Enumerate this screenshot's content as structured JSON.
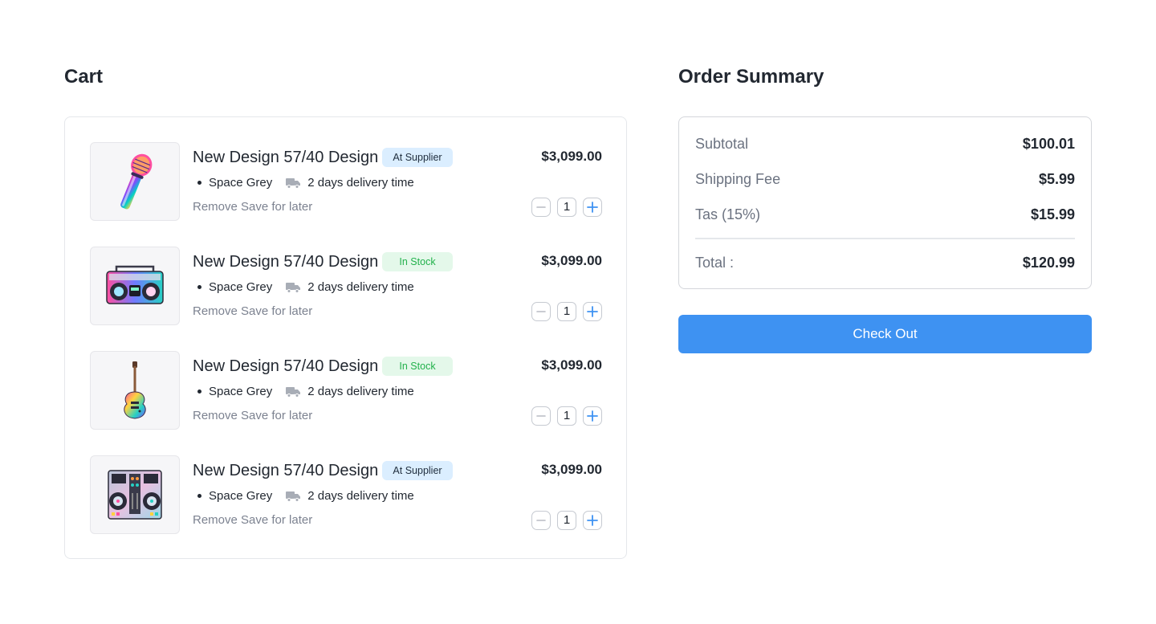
{
  "cart": {
    "title": "Cart",
    "items": [
      {
        "name": "New Design 57/40 Design",
        "badge": "At Supplier",
        "badge_type": "supplier",
        "price": "$3,099.00",
        "color": "Space Grey",
        "delivery": "2 days delivery time",
        "remove_label": "Remove",
        "save_label": "Save for later",
        "quantity": "1",
        "image_icon": "microphone-icon"
      },
      {
        "name": "New Design 57/40 Design",
        "badge": "In Stock",
        "badge_type": "stock",
        "price": "$3,099.00",
        "color": "Space Grey",
        "delivery": "2 days delivery time",
        "remove_label": "Remove",
        "save_label": "Save for later",
        "quantity": "1",
        "image_icon": "boombox-icon"
      },
      {
        "name": "New Design 57/40 Design",
        "badge": "In Stock",
        "badge_type": "stock",
        "price": "$3,099.00",
        "color": "Space Grey",
        "delivery": "2 days delivery time",
        "remove_label": "Remove",
        "save_label": "Save for later",
        "quantity": "1",
        "image_icon": "guitar-icon"
      },
      {
        "name": "New Design 57/40 Design",
        "badge": "At Supplier",
        "badge_type": "supplier",
        "price": "$3,099.00",
        "color": "Space Grey",
        "delivery": "2 days delivery time",
        "remove_label": "Remove",
        "save_label": "Save for later",
        "quantity": "1",
        "image_icon": "dj-controller-icon"
      }
    ]
  },
  "summary": {
    "title": "Order Summary",
    "subtotal_label": "Subtotal",
    "subtotal_value": "$100.01",
    "shipping_label": "Shipping Fee",
    "shipping_value": "$5.99",
    "tax_label": "Tas (15%)",
    "tax_value": "$15.99",
    "total_label": "Total :",
    "total_value": "$120.99",
    "checkout_label": "Check Out"
  },
  "colors": {
    "accent": "#3e92f2",
    "supplier_badge_bg": "#dbeeff",
    "stock_badge_bg": "#e4f8ea",
    "stock_badge_text": "#22b14c"
  }
}
